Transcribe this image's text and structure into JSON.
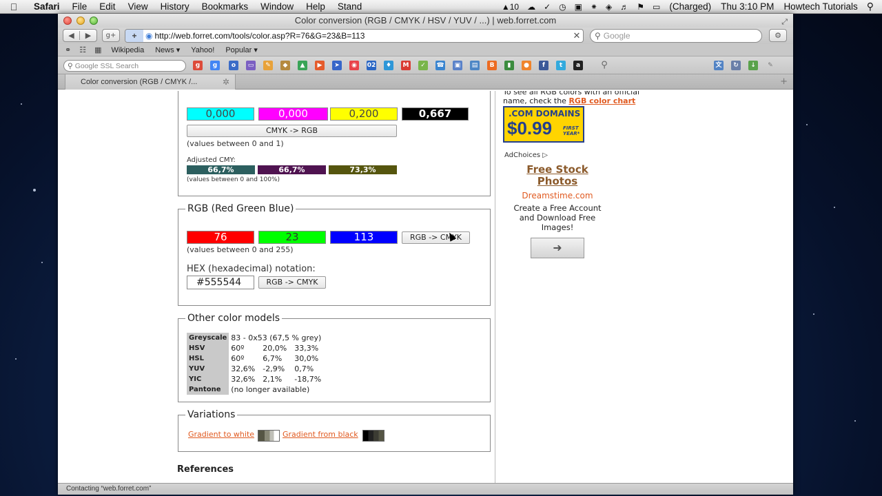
{
  "menubar": {
    "app": "Safari",
    "items": [
      "File",
      "Edit",
      "View",
      "History",
      "Bookmarks",
      "Window",
      "Help",
      "Stand"
    ],
    "adobe_count": "10",
    "battery": "(Charged)",
    "clock": "Thu 3:10 PM",
    "user": "Howtech Tutorials"
  },
  "window": {
    "title": "Color conversion (RGB / CMYK / HSV / YUV / ...) | web.forret.com",
    "url": "http://web.forret.com/tools/color.asp?R=76&G=23&B=113",
    "search_placeholder": "Google",
    "bookmarks": [
      "Wikipedia",
      "News ▾",
      "Yahoo!",
      "Popular ▾"
    ],
    "ssl_search_placeholder": "Google SSL Search",
    "tab_title": "Color conversion (RGB / CMYK /...",
    "status": "Contacting “web.forret.com”"
  },
  "cmyk": {
    "c": "0,000",
    "m": "0,000",
    "y": "0,200",
    "k": "0,667",
    "button": "CMYK -> RGB",
    "note": "(values between 0 and 1)",
    "adjusted_label": "Adjusted CMY:",
    "adjusted": [
      "66,7%",
      "66,7%",
      "73,3%"
    ],
    "adjusted_note": "(values between 0 and 100%)"
  },
  "rgb": {
    "legend": "RGB (Red Green Blue)",
    "r": "76",
    "g": "23",
    "b": "113",
    "button": "RGB -> CMYK",
    "note": "(values between 0 and 255)",
    "hex_label": "HEX (hexadecimal) notation:",
    "hex": "#555544",
    "hex_button": "RGB -> CMYK"
  },
  "other_models": {
    "legend": "Other color models",
    "rows": [
      {
        "label": "Greyscale",
        "v1": "83 - 0x53 (67,5 % grey)",
        "v2": "",
        "v3": ""
      },
      {
        "label": "HSV",
        "v1": "60º",
        "v2": "20,0%",
        "v3": "33,3%"
      },
      {
        "label": "HSL",
        "v1": "60º",
        "v2": "6,7%",
        "v3": "30,0%"
      },
      {
        "label": "YUV",
        "v1": "32,6%",
        "v2": "-2,9%",
        "v3": "0,7%"
      },
      {
        "label": "YIC",
        "v1": "32,6%",
        "v2": "2,1%",
        "v3": "-18,7%"
      },
      {
        "label": "Pantone",
        "v1": "(no longer available)",
        "v2": "",
        "v3": ""
      }
    ]
  },
  "variations": {
    "legend": "Variations",
    "to_white": "Gradient to white",
    "from_black": "Gradient from black"
  },
  "references": "References",
  "sidebar": {
    "intro_line1": "To see all RGB colors with an official",
    "intro_line2": "name, check the",
    "chart_link": "RGB color chart",
    "ad_domains": ".COM DOMAINS",
    "ad_price": "$0.99",
    "ad_first_year": "FIRST YEAR*",
    "adchoices": "AdChoices ▷",
    "stock_title": "Free Stock Photos",
    "dreamstime": "Dreamstime.com",
    "create_text": "Create a Free Account and Download Free Images!",
    "arrow": "➜"
  },
  "colors": {
    "cyan": "#00ffff",
    "magenta": "#ff00ff",
    "yellow": "#ffff00",
    "black": "#000000",
    "red": "#ff0000",
    "green": "#00ff00",
    "blue": "#0000ff",
    "link": "#e0591f"
  }
}
